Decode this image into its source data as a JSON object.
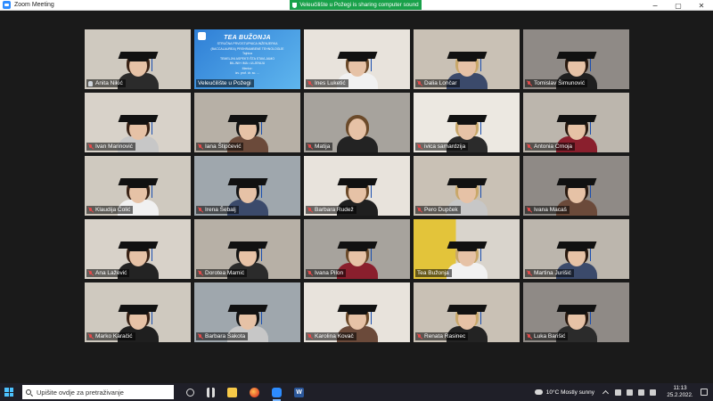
{
  "window": {
    "title": "Zoom Meeting",
    "controls": {
      "minimize": "−",
      "maximize": "▢",
      "close": "✕"
    }
  },
  "share_banner": {
    "text": "Veleučilište u Požegi is sharing computer sound"
  },
  "slide": {
    "title": "TEA BUŽONJA",
    "lines": [
      "STRUČNA PRVOSTUPNICA INŽENJERKA",
      "(BACCALAUREA) PREHRAMBENE TEHNOLOGIJE",
      "Tajnica",
      "TEMELJNI ASPEKTI ŠTA STAVLJAMO",
      "BILJNIH IMA • ULJENIJU",
      "Mentor:",
      "izv. prof. dr. sc. ..."
    ]
  },
  "participants": [
    {
      "name": "Anita Nikić",
      "icon": "raised-hand-icon"
    },
    {
      "name": "Veleučilište u Požegi",
      "icon": "none",
      "screen_share": true
    },
    {
      "name": "Ines Luketić",
      "icon": "mic-muted-icon"
    },
    {
      "name": "Dalia Lončar",
      "icon": "mic-muted-icon"
    },
    {
      "name": "Tomislav Šimunović",
      "icon": "mic-muted-icon"
    },
    {
      "name": "Ivan Marinović",
      "icon": "mic-muted-icon"
    },
    {
      "name": "Iana Štipčević",
      "icon": "mic-muted-icon"
    },
    {
      "name": "Matija",
      "icon": "mic-muted-icon"
    },
    {
      "name": "ivica samardzija",
      "icon": "mic-muted-icon"
    },
    {
      "name": "Antonia Crnoja",
      "icon": "mic-muted-icon"
    },
    {
      "name": "Klaudija Čolić",
      "icon": "mic-muted-icon"
    },
    {
      "name": "Irena Šebalj",
      "icon": "mic-muted-icon"
    },
    {
      "name": "Barbara Rudež",
      "icon": "mic-muted-icon"
    },
    {
      "name": "Pero Dupček",
      "icon": "mic-muted-icon"
    },
    {
      "name": "Ivana Macaš",
      "icon": "mic-muted-icon"
    },
    {
      "name": "Ana Lažević",
      "icon": "mic-muted-icon"
    },
    {
      "name": "Doroteа Mamić",
      "icon": "mic-muted-icon"
    },
    {
      "name": "Ivana Pilon",
      "icon": "mic-muted-icon"
    },
    {
      "name": "Tea Bužonja",
      "icon": "none",
      "active_speaker": true
    },
    {
      "name": "Martina Jurišić",
      "icon": "mic-muted-icon"
    },
    {
      "name": "Marko Karačić",
      "icon": "mic-muted-icon"
    },
    {
      "name": "Barbara Šakota",
      "icon": "mic-muted-icon"
    },
    {
      "name": "Karolina Kovač",
      "icon": "mic-muted-icon"
    },
    {
      "name": "Renata Rasinec",
      "icon": "mic-muted-icon"
    },
    {
      "name": "Luka Barišić",
      "icon": "mic-muted-icon"
    }
  ],
  "colors": {
    "share_banner": "#19a14a",
    "active_speaker_border": "#e0e34b",
    "muted_mic": "#e34a4a",
    "taskbar": "#1f1f28"
  },
  "taskbar": {
    "search_placeholder": "Upišite ovdje za pretraživanje",
    "pinned": [
      "task-view-icon",
      "widgets-icon",
      "file-explorer-icon",
      "firefox-icon",
      "zoom-icon",
      "word-icon"
    ],
    "word_letter": "W",
    "weather": "10°C  Mostly sunny",
    "time": "11:13",
    "date": "25.2.2022."
  }
}
